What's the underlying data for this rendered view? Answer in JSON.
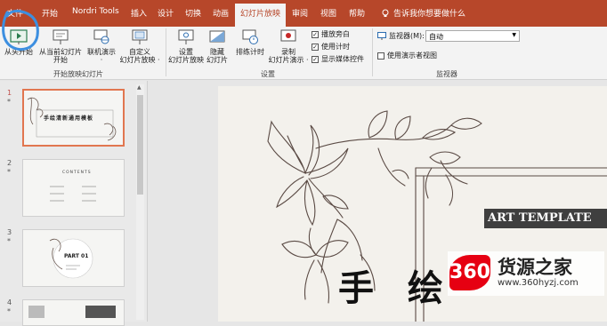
{
  "tabs": {
    "file": "文件",
    "home": "开始",
    "nordri": "Nordri Tools",
    "insert": "插入",
    "design": "设计",
    "transitions": "切换",
    "animations": "动画",
    "slideshow": "幻灯片放映",
    "review": "审阅",
    "view": "视图",
    "help": "帮助",
    "tell_me": "告诉我你想要做什么"
  },
  "ribbon": {
    "from_beginning": "从头开始",
    "from_current_1": "从当前幻灯片",
    "from_current_2": "开始",
    "online_1": "联机演示",
    "online_2": "·",
    "custom_1": "自定义",
    "custom_2": "幻灯片放映 ·",
    "group_start": "开始放映幻灯片",
    "setup_1": "设置",
    "setup_2": "幻灯片放映",
    "hide_1": "隐藏",
    "hide_2": "幻灯片",
    "rehearse": "排练计时",
    "record_1": "录制",
    "record_2": "幻灯片演示 ·",
    "play_narrations": "播放旁白",
    "use_timings": "使用计时",
    "show_media_controls": "显示媒体控件",
    "group_setup": "设置",
    "monitor_label": "监视器(M):",
    "monitor_value": "自动",
    "presenter_view": "使用演示者视图",
    "group_monitors": "监视器"
  },
  "thumbnails": {
    "numbers": [
      "1",
      "2",
      "3",
      "4"
    ],
    "star": "*",
    "t1_title": "手绘清新通用模板",
    "t2_title": "CONTENTS",
    "t3_title": "PART 01"
  },
  "slide": {
    "art_template": "ART TEMPLATE",
    "title": "手 绘"
  },
  "watermark": {
    "logo": "360",
    "name": "货源之家",
    "url": "www.360hyzj.com"
  },
  "colors": {
    "accent": "#b7472a",
    "selected_thumb": "#e1764f",
    "ink": "#5a4a44"
  }
}
